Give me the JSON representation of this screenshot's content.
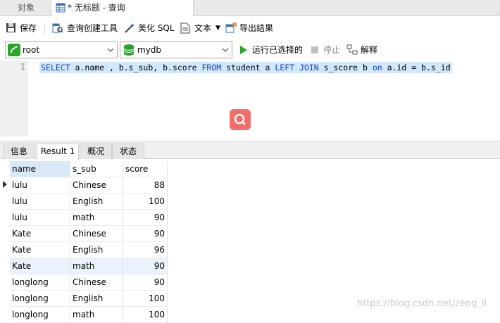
{
  "tabs": {
    "objects": "对象",
    "query": "* 无标题 - 查询"
  },
  "toolbar": {
    "save": "保存",
    "query_builder": "查询创建工具",
    "beautify": "美化 SQL",
    "text": "文本",
    "export": "导出结果"
  },
  "connection": {
    "value": "root"
  },
  "database": {
    "value": "mydb"
  },
  "actions": {
    "run_selected": "运行已选择的",
    "stop": "停止",
    "explain": "解释"
  },
  "editor": {
    "line_number": "1",
    "sql_tokens": [
      {
        "t": "SELECT",
        "k": true
      },
      {
        "t": " a.name , b.s_sub, b.score ",
        "k": false
      },
      {
        "t": "FROM",
        "k": true
      },
      {
        "t": " student a ",
        "k": false
      },
      {
        "t": "LEFT JOIN",
        "k": true
      },
      {
        "t": " s_score b ",
        "k": false
      },
      {
        "t": "on",
        "k": true
      },
      {
        "t": " a.id = b.s_id",
        "k": false
      }
    ]
  },
  "result_tabs": [
    "信息",
    "Result 1",
    "概况",
    "状态"
  ],
  "result": {
    "columns": [
      "name",
      "s_sub",
      "score"
    ],
    "rows": [
      [
        "lulu",
        "Chinese",
        "88"
      ],
      [
        "lulu",
        "English",
        "100"
      ],
      [
        "lulu",
        "math",
        "90"
      ],
      [
        "Kate",
        "Chinese",
        "90"
      ],
      [
        "Kate",
        "English",
        "96"
      ],
      [
        "Kate",
        "math",
        "90"
      ],
      [
        "longlong",
        "Chinese",
        "90"
      ],
      [
        "longlong",
        "English",
        "100"
      ],
      [
        "longlong",
        "math",
        "100"
      ]
    ]
  },
  "watermark": "https://blog.csdn.net/zeng_ll",
  "colors": {
    "keyword": "#1a3fc4",
    "selection": "#cfe8fc",
    "run_green": "#2aa52a",
    "fab": "#f26e6a"
  }
}
